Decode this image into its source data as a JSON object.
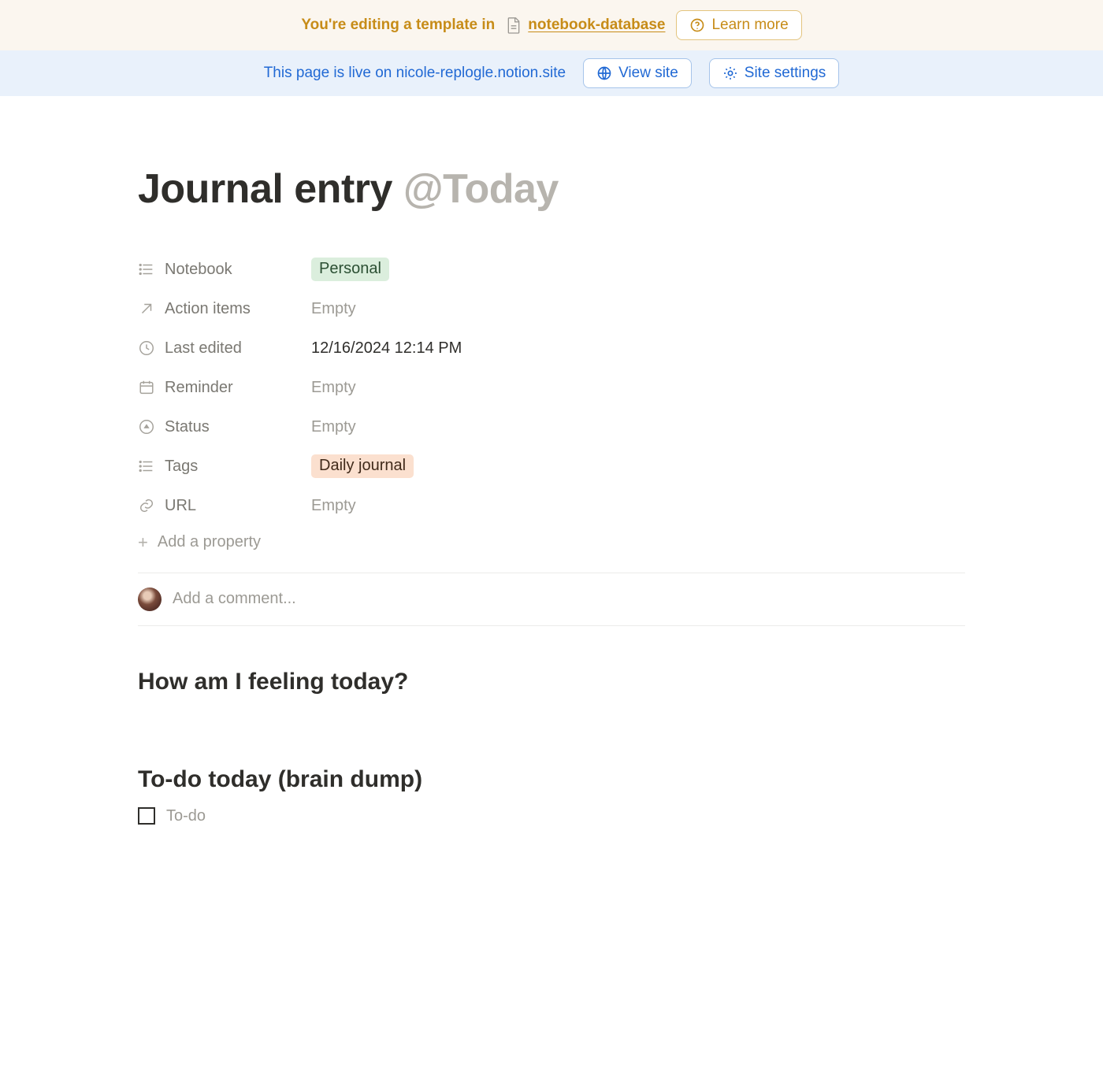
{
  "template_banner": {
    "lead": "You're editing a template in",
    "link_text": "notebook-database",
    "learn_more": "Learn more"
  },
  "live_banner": {
    "text": "This page is live on nicole-replogle.notion.site",
    "view_site": "View site",
    "site_settings": "Site settings"
  },
  "page_title": {
    "text": "Journal entry ",
    "mention": "@Today"
  },
  "properties": [
    {
      "icon": "list",
      "label": "Notebook",
      "value": "Personal",
      "display": "tag-green"
    },
    {
      "icon": "arrow",
      "label": "Action items",
      "value": "Empty",
      "display": "empty"
    },
    {
      "icon": "clock",
      "label": "Last edited",
      "value": "12/16/2024 12:14 PM",
      "display": "text"
    },
    {
      "icon": "calendar",
      "label": "Reminder",
      "value": "Empty",
      "display": "empty"
    },
    {
      "icon": "status",
      "label": "Status",
      "value": "Empty",
      "display": "empty"
    },
    {
      "icon": "list",
      "label": "Tags",
      "value": "Daily journal",
      "display": "tag-peach"
    },
    {
      "icon": "link",
      "label": "URL",
      "value": "Empty",
      "display": "empty"
    }
  ],
  "add_property_label": "Add a property",
  "comment_placeholder": "Add a comment...",
  "sections": {
    "feeling_heading": "How am I feeling today?",
    "todo_heading": "To-do today (brain dump)",
    "todo_placeholder": "To-do"
  }
}
